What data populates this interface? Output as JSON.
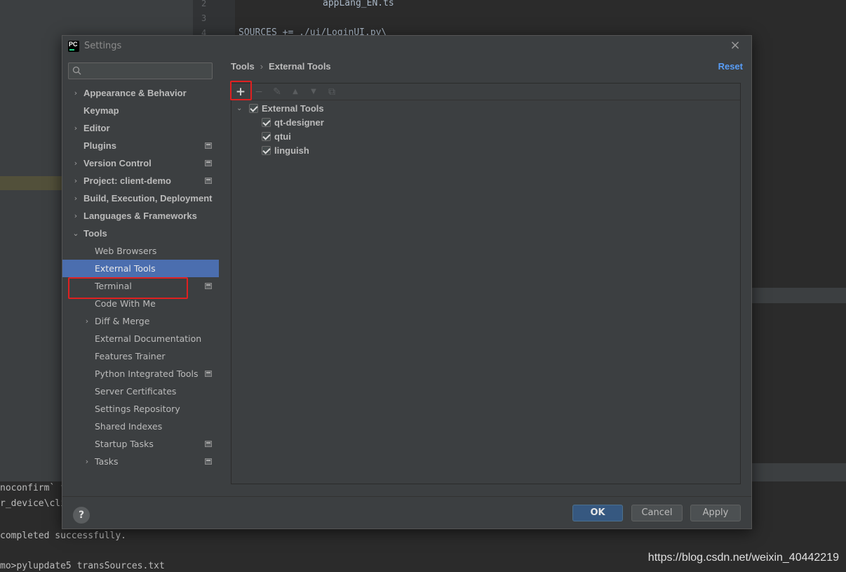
{
  "background": {
    "line_numbers": [
      "2",
      "3",
      "4"
    ],
    "code_lines": [
      "appLang_EN.ts",
      "SOURCES += ./ui/LoginUI.py\\"
    ],
    "terminal_lines": [
      "noconfirm` f",
      "r_device\\cli",
      "completed successfully.",
      "mo>pylupdate5 transSources.txt"
    ],
    "watermark": "https://blog.csdn.net/weixin_40442219"
  },
  "dialog": {
    "title": "Settings",
    "close_glyph": "×",
    "search": {
      "placeholder": "",
      "value": ""
    },
    "sidebar": {
      "items": [
        {
          "label": "Appearance & Behavior",
          "arrow": "›"
        },
        {
          "label": "Keymap",
          "arrow": ""
        },
        {
          "label": "Editor",
          "arrow": "›"
        },
        {
          "label": "Plugins",
          "arrow": ""
        },
        {
          "label": "Version Control",
          "arrow": "›"
        },
        {
          "label": "Project: client-demo",
          "arrow": "›"
        },
        {
          "label": "Build, Execution, Deployment",
          "arrow": "›"
        },
        {
          "label": "Languages & Frameworks",
          "arrow": "›"
        },
        {
          "label": "Tools",
          "arrow": "⌄"
        },
        {
          "label": "Web Browsers"
        },
        {
          "label": "External Tools"
        },
        {
          "label": "Terminal"
        },
        {
          "label": "Code With Me"
        },
        {
          "label": "Diff & Merge",
          "arrow": "›"
        },
        {
          "label": "External Documentation"
        },
        {
          "label": "Features Trainer"
        },
        {
          "label": "Python Integrated Tools"
        },
        {
          "label": "Server Certificates"
        },
        {
          "label": "Settings Repository"
        },
        {
          "label": "Shared Indexes"
        },
        {
          "label": "Startup Tasks"
        },
        {
          "label": "Tasks",
          "arrow": "›"
        }
      ],
      "selected": "External Tools"
    },
    "breadcrumb": {
      "parent": "Tools",
      "separator": "›",
      "current": "External Tools"
    },
    "reset_label": "Reset",
    "toolbar": {
      "add": "+",
      "remove": "−",
      "edit": "✎",
      "up": "▲",
      "down": "▼",
      "copy": "⧉"
    },
    "tools_tree": {
      "group": {
        "label": "External Tools",
        "checked": true,
        "arrow": "⌄"
      },
      "children": [
        {
          "label": "qt-designer",
          "checked": true
        },
        {
          "label": "qtui",
          "checked": true
        },
        {
          "label": "linguish",
          "checked": true
        }
      ]
    },
    "footer": {
      "help": "?",
      "ok": "OK",
      "cancel": "Cancel",
      "apply": "Apply"
    }
  },
  "colors": {
    "selection": "#4b6eaf",
    "link": "#589df6",
    "ok_button": "#365880",
    "highlight_box": "#e02020"
  }
}
